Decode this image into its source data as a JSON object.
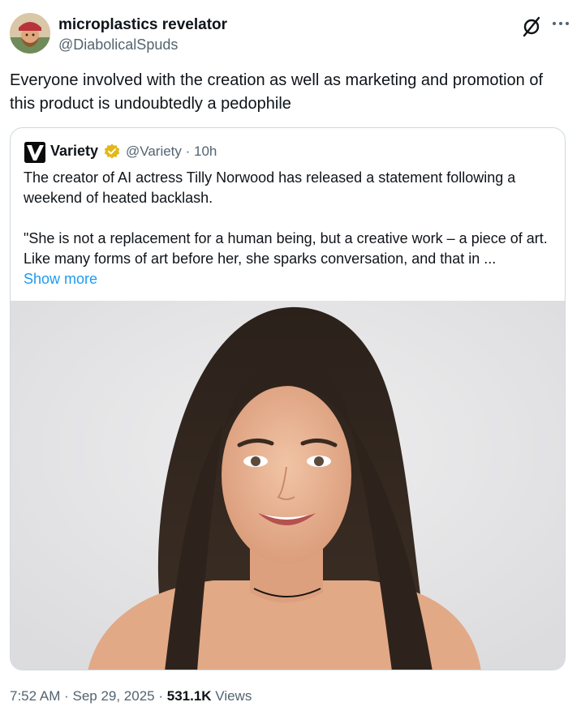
{
  "tweet": {
    "author": {
      "display_name": "microplastics revelator",
      "handle": "@DiabolicalSpuds"
    },
    "text": "Everyone involved with the creation as well as marketing and promotion of this product is undoubtedly a pedophile",
    "icons": {
      "grok": "grok-icon",
      "more": "more-options-icon"
    },
    "timestamp": "7:52 AM · Sep 29, 2025 · ",
    "views_count": "531.1K",
    "views_label": " Views"
  },
  "quote": {
    "logo_letter": "V",
    "name": "Variety",
    "badge_color": "#e2b719",
    "meta": "@Variety · 10h",
    "paragraph1": "The creator of AI actress Tilly Norwood has released a statement following a weekend of heated backlash.",
    "paragraph2": "\"She is not a replacement for a human being, but a creative work – a piece of art. Like many forms of art before her, she sparks conversation, and that in ...",
    "show_more": "Show more",
    "media_description": "photo"
  },
  "colors": {
    "link": "#1d9bf0",
    "secondary_text": "#536471",
    "border": "#cfd9de"
  }
}
